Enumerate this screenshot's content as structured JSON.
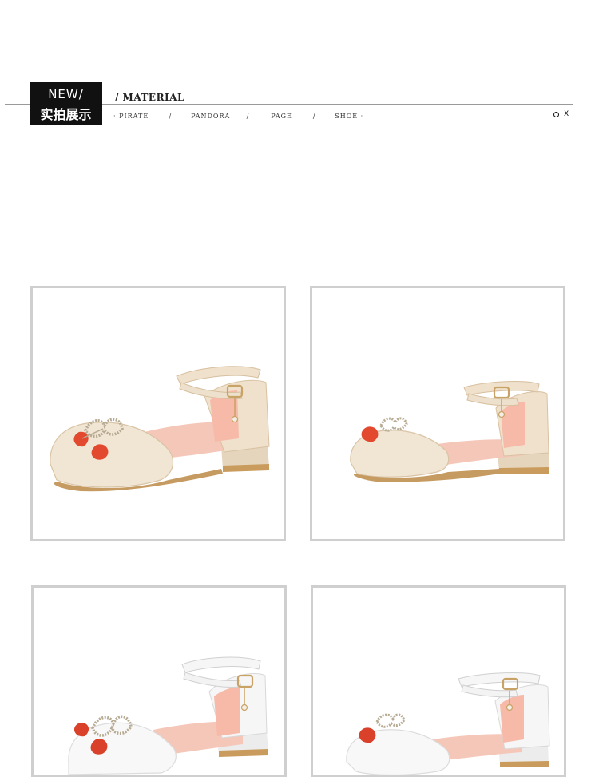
{
  "header": {
    "badge_line1": "NEW/",
    "badge_line2": "实拍展示",
    "title": "/ MATERIAL",
    "nav": [
      {
        "label": "· PIRATE"
      },
      {
        "label": "/"
      },
      {
        "label": "PANDORA"
      },
      {
        "label": "/"
      },
      {
        "label": "PAGE"
      },
      {
        "label": "/"
      },
      {
        "label": "SHOE ·"
      }
    ],
    "close_label": "X"
  },
  "products": [
    {
      "color": "beige",
      "accent": "#f0e3d2"
    },
    {
      "color": "beige",
      "accent": "#f0e3d2"
    },
    {
      "color": "white",
      "accent": "#f7f7f7"
    },
    {
      "color": "white",
      "accent": "#f7f7f7"
    }
  ],
  "icons": {
    "bow": "rhinestone-bow-icon",
    "cherry": "cherry-charm-icon"
  }
}
